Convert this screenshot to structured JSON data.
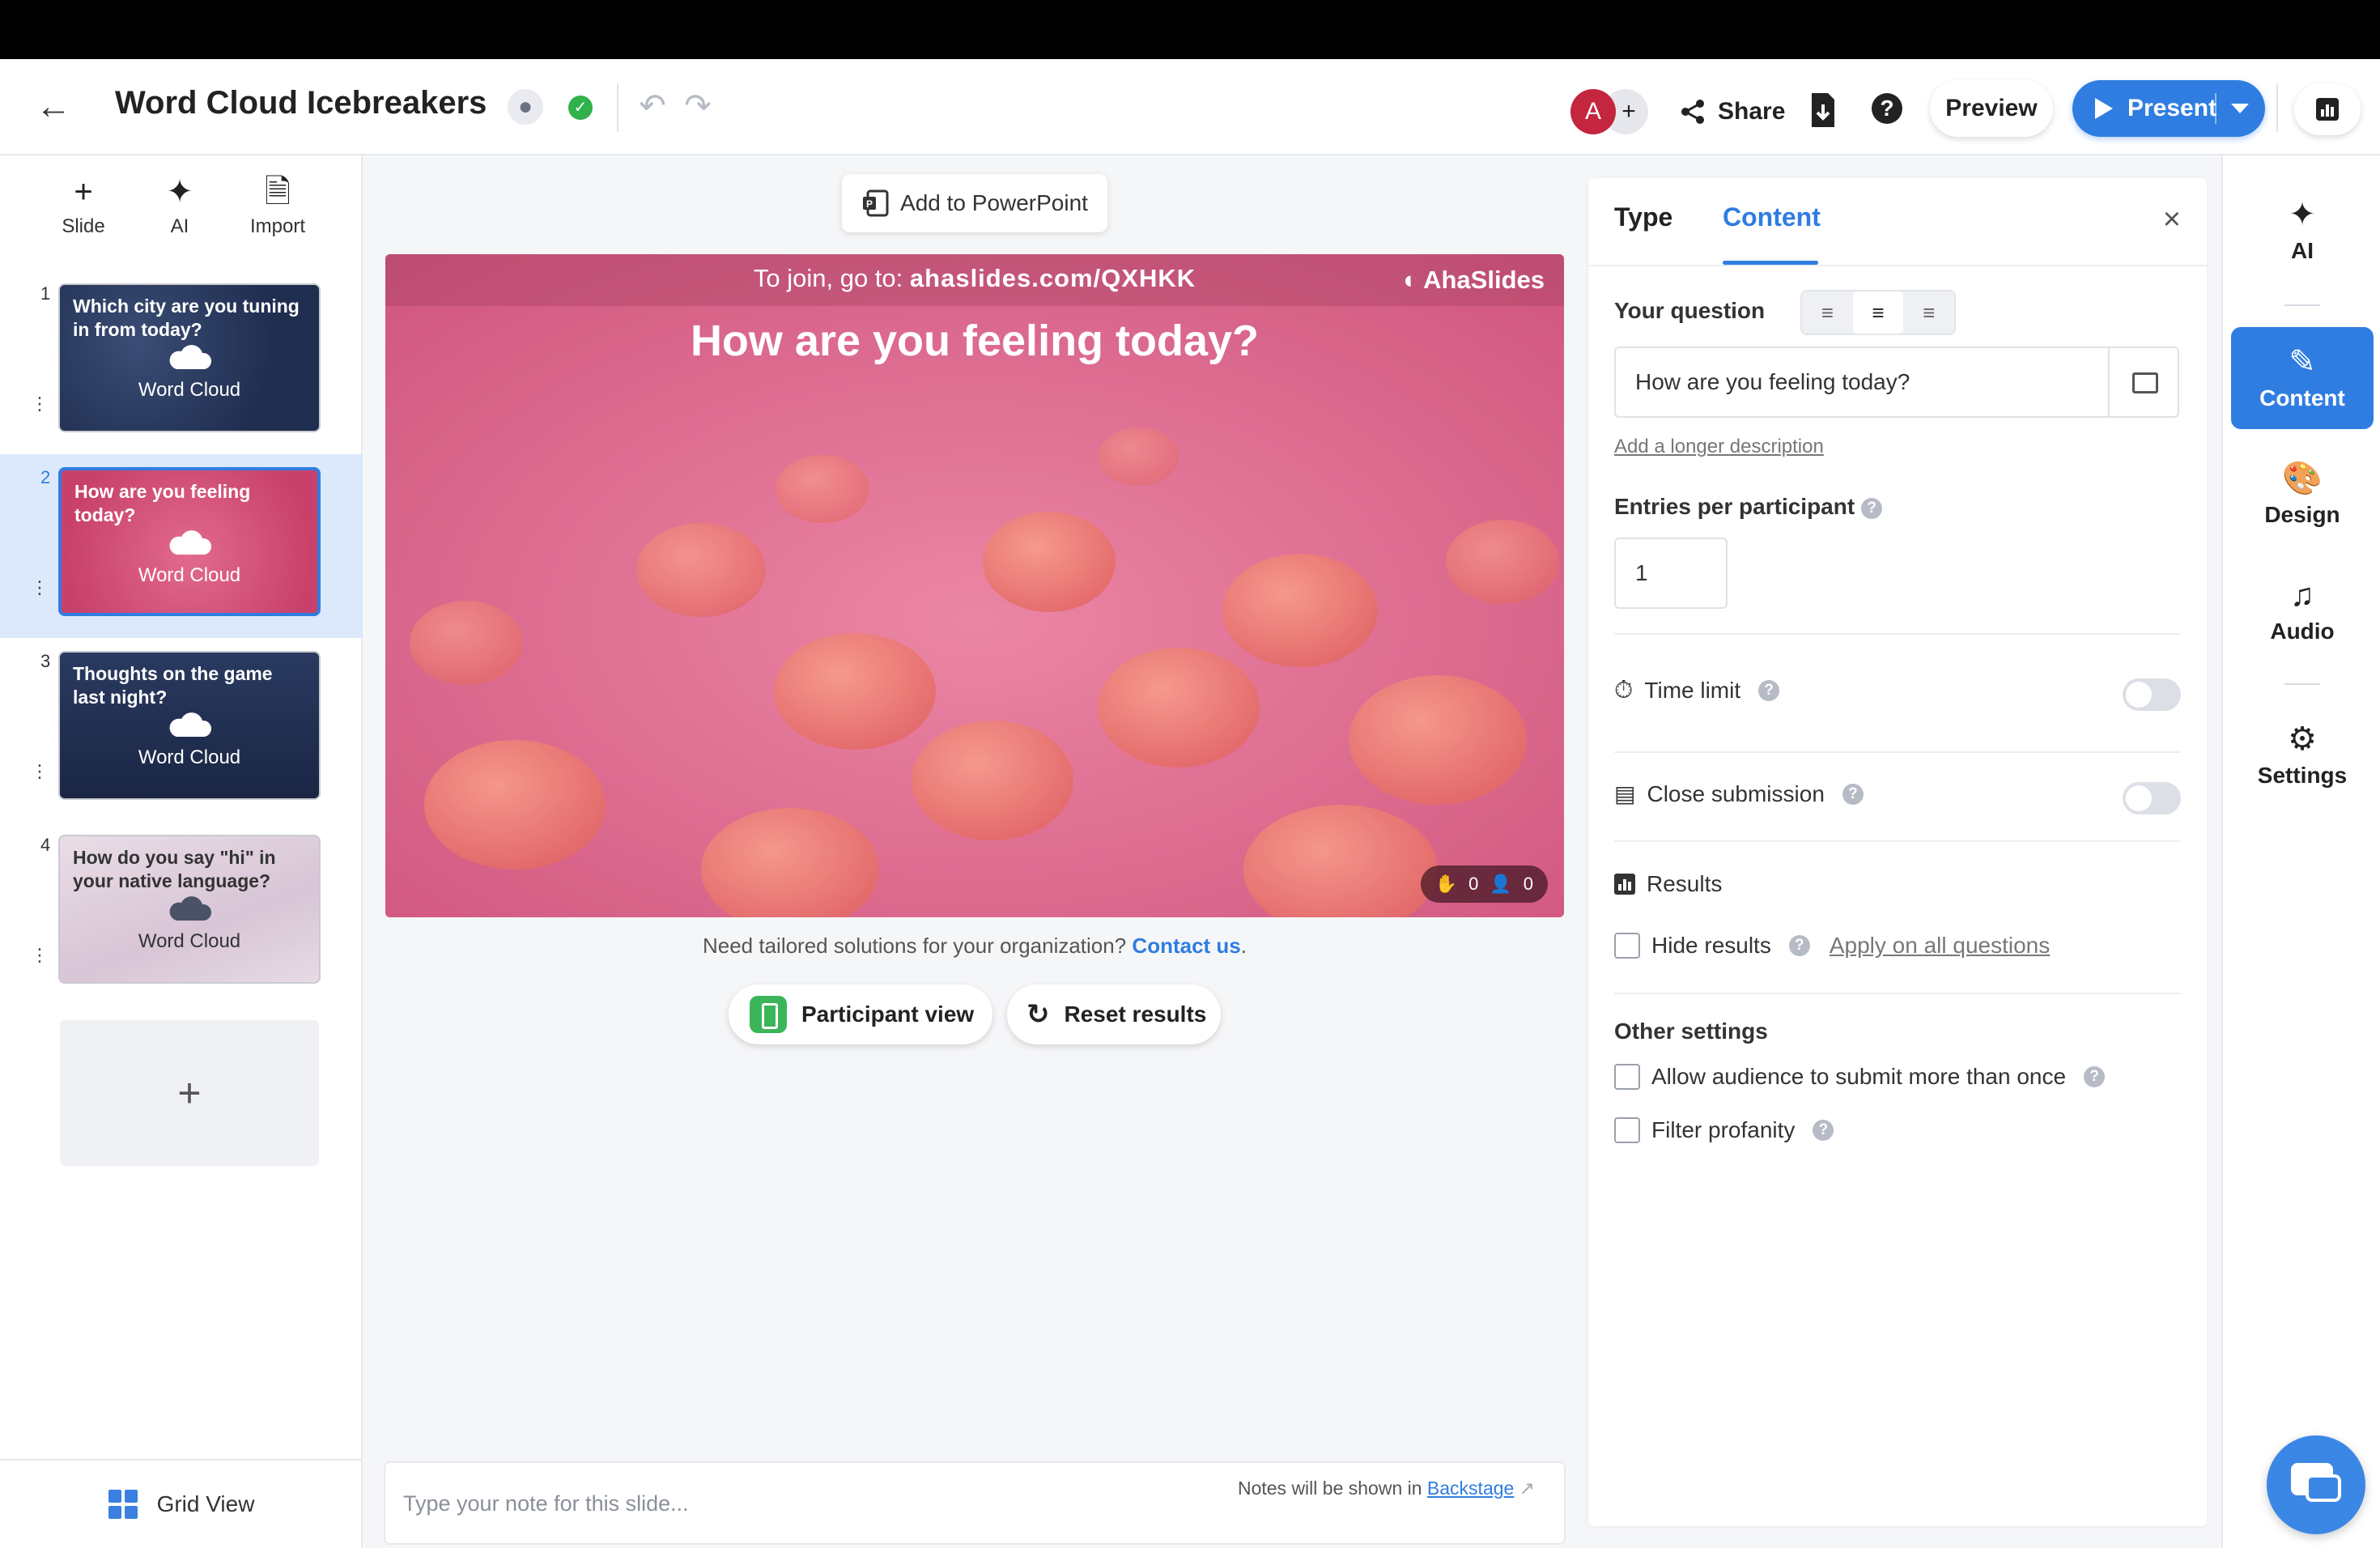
{
  "header": {
    "title": "Word Cloud Icebreakers",
    "avatar_initial": "A",
    "avatar_add": "+",
    "share_label": "Share",
    "help_label": "?",
    "preview_label": "Preview",
    "present_label": "Present"
  },
  "left_tools": [
    {
      "label": "Slide",
      "icon": "plus-icon"
    },
    {
      "label": "AI",
      "icon": "sparkle-icon"
    },
    {
      "label": "Import",
      "icon": "import-file-icon"
    }
  ],
  "slides": [
    {
      "number": "1",
      "title": "Which city are you tuning in from today?",
      "type": "Word Cloud"
    },
    {
      "number": "2",
      "title": "How are you feeling today?",
      "type": "Word Cloud",
      "active": true
    },
    {
      "number": "3",
      "title": "Thoughts on the game last night?",
      "type": "Word Cloud"
    },
    {
      "number": "4",
      "title": "How do you say \"hi\" in your native language?",
      "type": "Word Cloud"
    }
  ],
  "add_slide_label": "+",
  "grid_view_label": "Grid View",
  "canvas": {
    "add_ppt_label": "Add to PowerPoint",
    "join_prefix": "To join, go to:",
    "join_url": "ahaslides.com/QXHKK",
    "brand": "AhaSlides",
    "question": "How are you feeling today?",
    "reactions_count": "0",
    "participants_count": "0",
    "tailored_text": "Need tailored solutions for your organization?",
    "contact_link": "Contact us",
    "contact_suffix": ".",
    "participant_view_label": "Participant view",
    "reset_results_label": "Reset results"
  },
  "notes": {
    "placeholder": "Type your note for this slide...",
    "hint_prefix": "Notes will be shown in",
    "hint_link": "Backstage"
  },
  "panel": {
    "tab_type": "Type",
    "tab_content": "Content",
    "close_label": "×",
    "your_question_label": "Your question",
    "question_value": "How are you feeling today?",
    "long_description_link": "Add a longer description",
    "entries_label": "Entries per participant",
    "entries_value": "1",
    "time_limit_label": "Time limit",
    "close_submission_label": "Close submission",
    "results_label": "Results",
    "hide_results_label": "Hide results",
    "apply_all_label": "Apply on all questions",
    "other_settings_label": "Other settings",
    "allow_multiple_label": "Allow audience to submit more than once",
    "filter_profanity_label": "Filter profanity",
    "help_mark": "?"
  },
  "rail": [
    {
      "label": "AI",
      "icon": "sparkle-icon"
    },
    {
      "label": "Content",
      "icon": "pencil-icon",
      "active": true
    },
    {
      "label": "Design",
      "icon": "palette-icon"
    },
    {
      "label": "Audio",
      "icon": "music-note-icon"
    },
    {
      "label": "Settings",
      "icon": "gear-icon"
    }
  ],
  "colors": {
    "accent": "#2f7de1",
    "avatar": "#c4253f",
    "slide_pink": "#d86a8c",
    "success": "#30b14a"
  }
}
